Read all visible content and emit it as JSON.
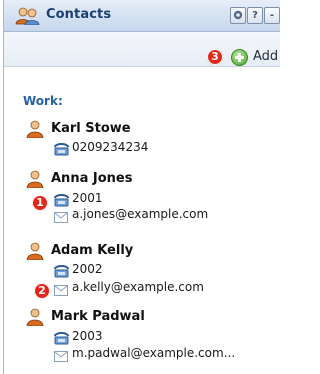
{
  "header": {
    "title": "Contacts",
    "buttons": [
      {
        "icon": "gear-icon"
      },
      {
        "label": "?"
      },
      {
        "label": "-"
      }
    ]
  },
  "toolbar": {
    "add_label": "Add",
    "badge": "3"
  },
  "group": {
    "label": "Work:"
  },
  "contacts": [
    {
      "name": "Karl Stowe",
      "phone": "0209234234",
      "email": ""
    },
    {
      "name": "Anna Jones",
      "phone": "2001",
      "email": "a.jones@example.com"
    },
    {
      "name": "Adam Kelly",
      "phone": "2002",
      "email": "a.kelly@example.com"
    },
    {
      "name": "Mark Padwal",
      "phone": "2003",
      "email": "m.padwal@example.com..."
    }
  ],
  "badges": {
    "one": "1",
    "two": "2"
  },
  "colors": {
    "title": "#1a3f73",
    "group": "#2563a6",
    "badge": "#e3261c",
    "add": "#4aa52b"
  }
}
